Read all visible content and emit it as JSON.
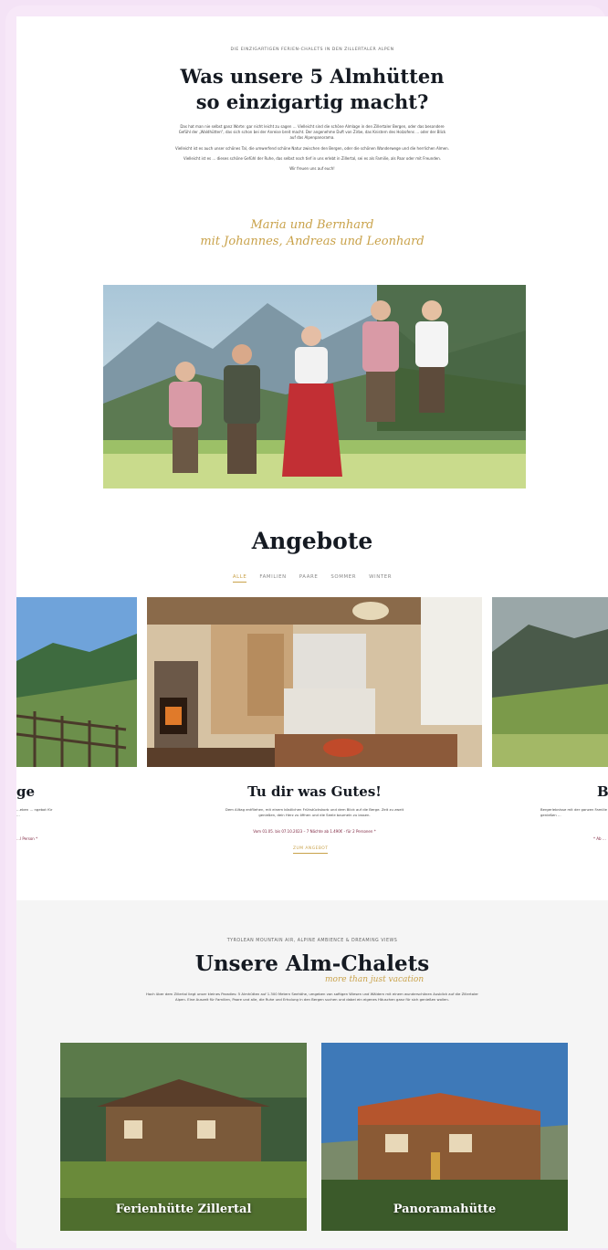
{
  "intro": {
    "eyebrow": "DIE EINZIGARTIGEN FERIEN-CHALETS IN DEN ZILLERTALER ALPEN",
    "title_line1": "Was unsere 5 Almhütten",
    "title_line2": "so einzigartig macht?",
    "paragraphs": [
      "Das hat man nie selbst ganz Worte: gar nicht leicht zu sagen … Vielleicht sind die schöne Almlage in den Zillertaler Bergen, oder das besondere Gefühl der „Waldhütten“, das sich schon bei der Anreise breit macht. Der angenehme Duft von Zirbe, das Knistern des Holzofens … oder der Blick auf das Alpenpanorama.",
      "Vielleicht ist es auch unser schönes Tal, die umwerfend schöne Natur zwischen den Bergen, oder die schönen Wanderwege und die herrlichen Almen.",
      "Vielleicht ist es … dieses schöne Gefühl der Ruhe, das selbst noch tief in uns erlebt in Zillertal, sei es als Familie, als Paar oder mit Freunden.",
      "Wir freuen uns auf euch!"
    ],
    "signature_line1": "Maria und Bernhard",
    "signature_line2": "mit Johannes, Andreas und Leonhard"
  },
  "offers": {
    "title": "Angebote",
    "tabs": [
      "ALLE",
      "FAMILIEN",
      "PAARE",
      "SOMMER",
      "WINTER"
    ],
    "active_tab": 0,
    "cards": [
      {
        "title": "ge",
        "text": "…eben … ngebot für …",
        "price": "…l Person *"
      },
      {
        "title": "Tu dir was Gutes!",
        "text": "Dem Alltag entfliehen, mit einem köstlichen Frühstückskorb und dem Blick auf die Berge. Zeit zu zweit genießen, dein Herz zu öffnen und die Seele baumeln zu lassen.",
        "price": "Vom 01.05. bis 07.10.2023 – 7 Nächte ab 1.490€ - für 2 Personen *",
        "button": "ZUM ANGEBOT"
      },
      {
        "title": "B",
        "text": "Bergerlebnisse mit der ganzen Familie genießen …",
        "price": "* Ab …"
      }
    ]
  },
  "chalets": {
    "eyebrow": "TYROLEAN MOUNTAIN AIR, ALPINE AMBIENCE & DREAMING VIEWS",
    "title": "Unsere Alm-Chalets",
    "subtitle": "more than just vacation",
    "intro": "Hoch über dem Zillertal liegt unser kleines Paradies: 5 Almhütten auf 1.300 Metern Seehöhe, umgeben von saftigen Wiesen und Wäldern mit einem wunderschönen Ausblick auf die Zillertaler Alpen. Eine Auszeit für Familien, Paare und alle, die Ruhe und Erholung in den Bergen suchen und dabei ein eigenes Häuschen ganz für sich genießen wollen.",
    "items": [
      {
        "name": "Ferienhütte Zillertal"
      },
      {
        "name": "Panoramahütte"
      }
    ]
  },
  "colors": {
    "accent": "#c9a24a",
    "price": "#7a1f3a",
    "heading": "#151a22"
  }
}
